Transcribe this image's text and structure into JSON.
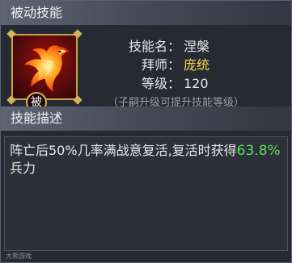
{
  "header": {
    "passive_skill_title": "被动技能"
  },
  "skill": {
    "tag_char": "被",
    "name_label": "技能名：",
    "name_value": "涅槃",
    "teacher_label": "拜师：",
    "teacher_value": "庞统",
    "level_label": "等级：",
    "level_value": "120",
    "hint": "（子嗣升级可提升技能等级）",
    "icon": "phoenix-icon"
  },
  "description": {
    "title": "技能描述",
    "text_before": "阵亡后50%几率满战意复活,复活时获得",
    "highlight": "63.8%",
    "text_after": "兵力"
  },
  "watermark": "大熊游戏",
  "colors": {
    "teacher": "#ffd54a",
    "highlight": "#5fe05a"
  }
}
